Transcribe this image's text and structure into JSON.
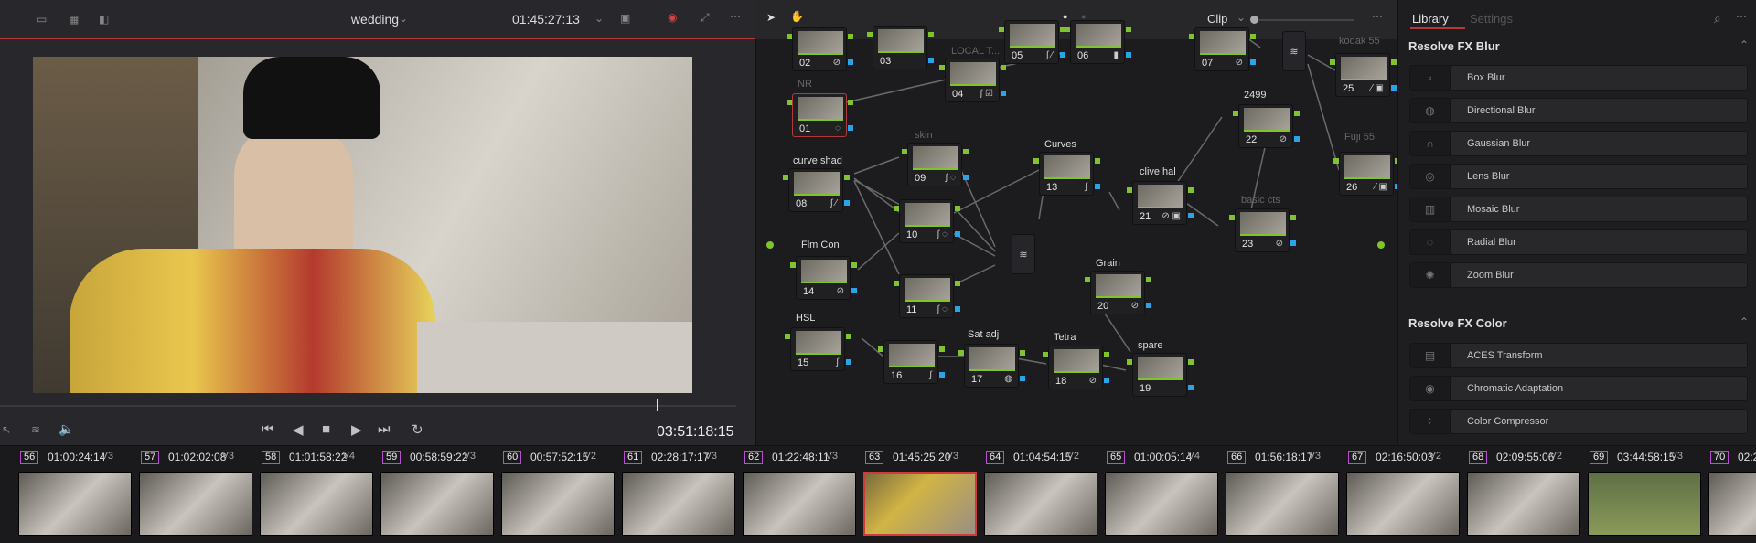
{
  "viewer": {
    "project_name": "wedding",
    "source_timecode": "01:45:27:13",
    "playback_timecode": "03:51:18:15"
  },
  "node_editor": {
    "mode": "Clip",
    "nodes": [
      {
        "id": "02",
        "label": ""
      },
      {
        "id": "03",
        "label": ""
      },
      {
        "id": "04",
        "label": "LOCAL T..."
      },
      {
        "id": "05",
        "label": ""
      },
      {
        "id": "06",
        "label": ""
      },
      {
        "id": "07",
        "label": ""
      },
      {
        "id": "01",
        "label": "NR"
      },
      {
        "id": "08",
        "label": "curve shad"
      },
      {
        "id": "09",
        "label": "skin"
      },
      {
        "id": "10",
        "label": ""
      },
      {
        "id": "11",
        "label": ""
      },
      {
        "id": "13",
        "label": "Curves"
      },
      {
        "id": "21",
        "label": "clive hal"
      },
      {
        "id": "22",
        "label": "2499"
      },
      {
        "id": "23",
        "label": "basic cts"
      },
      {
        "id": "25",
        "label": "kodak 55"
      },
      {
        "id": "26",
        "label": "Fuji 55"
      },
      {
        "id": "14",
        "label": "Flm Con"
      },
      {
        "id": "20",
        "label": "Grain"
      },
      {
        "id": "15",
        "label": "HSL"
      },
      {
        "id": "16",
        "label": ""
      },
      {
        "id": "17",
        "label": "Sat adj"
      },
      {
        "id": "18",
        "label": "Tetra"
      },
      {
        "id": "19",
        "label": "spare"
      }
    ]
  },
  "library": {
    "tab_library": "Library",
    "tab_settings": "Settings",
    "sections": [
      {
        "title": "Resolve FX Blur",
        "items": [
          "Box Blur",
          "Directional Blur",
          "Gaussian Blur",
          "Lens Blur",
          "Mosaic Blur",
          "Radial Blur",
          "Zoom Blur"
        ]
      },
      {
        "title": "Resolve FX Color",
        "items": [
          "ACES Transform",
          "Chromatic Adaptation",
          "Color Compressor"
        ]
      }
    ]
  },
  "clips": [
    {
      "num": "56",
      "tc": "01:00:24:14",
      "track": "V3"
    },
    {
      "num": "57",
      "tc": "01:02:02:08",
      "track": "V3"
    },
    {
      "num": "58",
      "tc": "01:01:58:22",
      "track": "V4"
    },
    {
      "num": "59",
      "tc": "00:58:59:22",
      "track": "V3"
    },
    {
      "num": "60",
      "tc": "00:57:52:15",
      "track": "V2"
    },
    {
      "num": "61",
      "tc": "02:28:17:17",
      "track": "V3"
    },
    {
      "num": "62",
      "tc": "01:22:48:11",
      "track": "V3"
    },
    {
      "num": "63",
      "tc": "01:45:25:20",
      "track": "V3"
    },
    {
      "num": "64",
      "tc": "01:04:54:15",
      "track": "V2"
    },
    {
      "num": "65",
      "tc": "01:00:05:14",
      "track": "V4"
    },
    {
      "num": "66",
      "tc": "01:56:18:17",
      "track": "V3"
    },
    {
      "num": "67",
      "tc": "02:16:50:03",
      "track": "V2"
    },
    {
      "num": "68",
      "tc": "02:09:55:06",
      "track": "V2"
    },
    {
      "num": "69",
      "tc": "03:44:58:15",
      "track": "V3"
    },
    {
      "num": "70",
      "tc": "02:2",
      "track": ""
    }
  ],
  "colors": {
    "accent_red": "#b23a3a",
    "node_green": "#7fc42d",
    "node_blue": "#29a4e8",
    "clip_badge": "#b64fd0"
  }
}
